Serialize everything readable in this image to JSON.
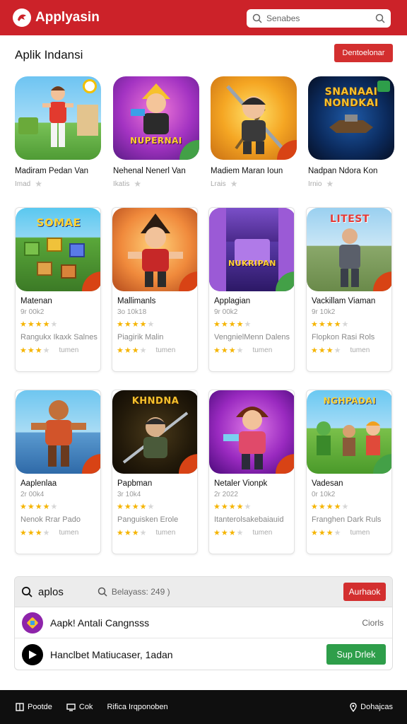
{
  "header": {
    "brand": "Applyasin",
    "search_placeholder": "Senabes"
  },
  "section": {
    "title": "Aplik Indansi",
    "cta": "Dentoelonar"
  },
  "featured": [
    {
      "name": "Madiram Pedan Van",
      "sub": "Imad",
      "art": ""
    },
    {
      "name": "Nehenal Nenerl Van",
      "sub": "Ikatis",
      "art": "NUPERNAI"
    },
    {
      "name": "Madiem Maran Ioun",
      "sub": "Lrais",
      "art": ""
    },
    {
      "name": "Nadpan Ndora Kon",
      "sub": "Irnio",
      "art": "SNANAAI NONDKAI"
    }
  ],
  "cards": [
    {
      "name": "Matenan",
      "year": "9r 00k2",
      "desc": "Rangukx Ikaxk Salnes",
      "label": "tumen",
      "stars": 4,
      "stars2": 3,
      "art": "SOMAE"
    },
    {
      "name": "Mallimanls",
      "year": "3o 10k18",
      "desc": "Piagirik Malin",
      "label": "tumen",
      "stars": 4,
      "stars2": 3,
      "art": ""
    },
    {
      "name": "Applagian",
      "year": "9r 00k2",
      "desc": "VengnielMenn Dalens",
      "label": "tumen",
      "stars": 4,
      "stars2": 3,
      "art": "NUKRIPAN"
    },
    {
      "name": "Vackillam Viaman",
      "year": "9r 10k2",
      "desc": "Flopkon Rasi Rols",
      "label": "tumen",
      "stars": 4,
      "stars2": 3,
      "art": "LITEST"
    },
    {
      "name": "Aaplenlaa",
      "year": "2r 00k4",
      "desc": "Nenok Rrar Pado",
      "label": "tumen",
      "stars": 4,
      "stars2": 3,
      "art": ""
    },
    {
      "name": "Papbman",
      "year": "3r 10k4",
      "desc": "Panguisken Erole",
      "label": "tumen",
      "stars": 4,
      "stars2": 3,
      "art": "KHNDNA"
    },
    {
      "name": "Netaler Vionpk",
      "year": "2r 2022",
      "desc": "Itanterolsakebaiauid",
      "label": "tumen",
      "stars": 4,
      "stars2": 3,
      "art": ""
    },
    {
      "name": "Vadesan",
      "year": "0r 10k2",
      "desc": "Franghen Dark Ruls",
      "label": "tumen",
      "stars": 4,
      "stars2": 3,
      "art": "NGHPADAI"
    }
  ],
  "panel": {
    "label": "aplos",
    "search": "Belayass: 249 )",
    "action": "Aurhaok",
    "rows": [
      {
        "title": "Aapk! Antali Cangnsss",
        "right": "Ciorls"
      },
      {
        "title": "Hanclbet Matiucaser, 1adan",
        "button": "Sup Drlek"
      }
    ]
  },
  "footer": {
    "item1": "Pootde",
    "item2": "Cok",
    "item3": "Rifica Irqponoben",
    "item4": "Dohajcas"
  },
  "colors": {
    "brand_red": "#cc2229",
    "action_red": "#d32f2f",
    "green": "#2e9e4a",
    "star": "#f5b400"
  }
}
